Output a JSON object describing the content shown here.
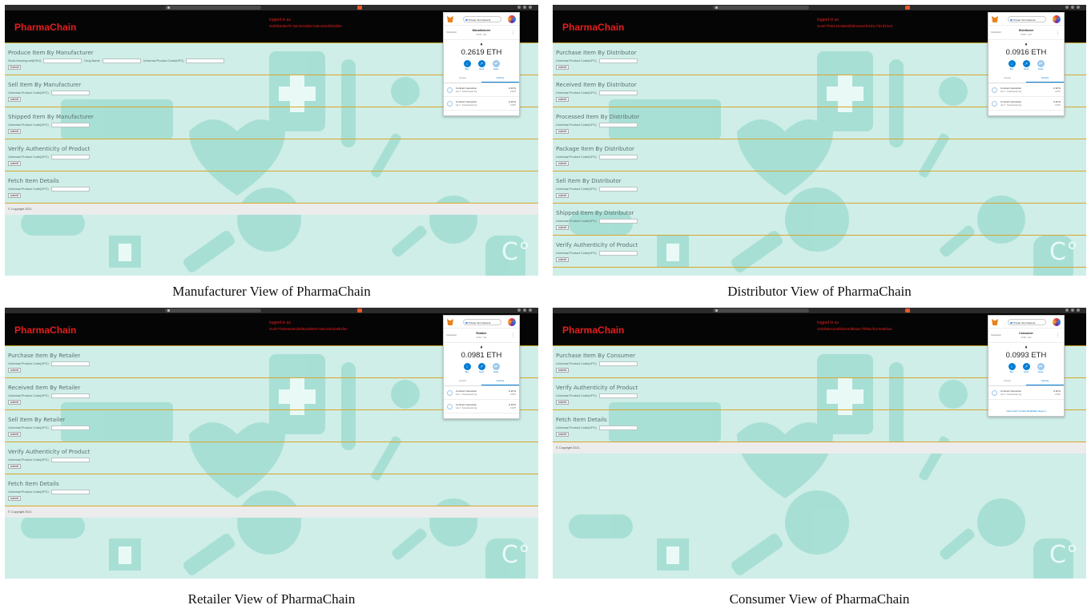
{
  "panels": [
    {
      "caption": "Manufacturer View of PharmaChain",
      "brand": "PharmaChain",
      "logged_label": "logged in as",
      "logged_address": "0x9f3ba09a7fc7a5c9c94d0c7a9e4e6c0f5d4bbe",
      "sections": [
        {
          "title": "Produce Item By Manufacturer",
          "fields": [
            "Stock keeping unit(SKU)",
            "Drug Name",
            "Universal Product Code(UPC)"
          ],
          "submit": "Submit"
        },
        {
          "title": "Sell Item By Manufacturer",
          "fields": [
            "Universal Product Code(UPC)"
          ],
          "submit": "submit"
        },
        {
          "title": "Shipped Item By Manufacturer",
          "fields": [
            "Universal Product Code(UPC)"
          ],
          "submit": "submit"
        },
        {
          "title": "Verify Authenticity of Product",
          "fields": [
            "Universal Product Code(UPC)"
          ],
          "submit": "submit"
        },
        {
          "title": "Fetch Item Details",
          "fields": [
            "Universal Product Code(UPC)"
          ],
          "submit": "submit"
        }
      ],
      "footer": "© Copyright 2021.",
      "metamask": {
        "network": "Private Test Network",
        "connected": "Connected",
        "account": "Manufacturer",
        "address": "0x9f3...bbe",
        "eth_icon": "♦",
        "balance": "0.2619 ETH",
        "actions": [
          "Buy",
          "Send",
          "Swap"
        ],
        "tabs": [
          "Assets",
          "Activity"
        ],
        "transactions": [
          {
            "title": "Contract Interaction",
            "sub": "Jan 3 · Tests/Interact.Ing",
            "amount": "-0 ETH",
            "fiat": "-0 ETH"
          },
          {
            "title": "Contract Interaction",
            "sub": "Jan 3 · Tests/Interact.Ing",
            "amount": "-0 ETH",
            "fiat": "-0 ETH"
          }
        ],
        "help": ""
      }
    },
    {
      "caption": "Distributor View of PharmaChain",
      "brand": "PharmaChain",
      "logged_label": "logged in as",
      "logged_address": "0x4877b60c1b4a5e9f26be4ea1f44d1c74b1f10e3",
      "sections": [
        {
          "title": "Purchase Item By Distributor",
          "fields": [
            "Universal Product Code(UPC)"
          ],
          "submit": "submit"
        },
        {
          "title": "Received Item By Distributor",
          "fields": [
            "Universal Product Code(UPC)"
          ],
          "submit": "submit"
        },
        {
          "title": "Processed Item By Distributor",
          "fields": [
            "Universal Product Code(UPC)"
          ],
          "submit": "submit"
        },
        {
          "title": "Package Item By Distributor",
          "fields": [
            "Universal Product Code(UPC)"
          ],
          "submit": "submit"
        },
        {
          "title": "Sell Item By Distributor",
          "fields": [
            "Universal Product Code(UPC)"
          ],
          "submit": "submit"
        },
        {
          "title": "Shipped Item By Distributor",
          "fields": [
            "Universal Product Code(UPC)"
          ],
          "submit": "submit"
        },
        {
          "title": "Verify Authenticity of Product",
          "fields": [
            "Universal Product Code(UPC)"
          ],
          "submit": "submit"
        }
      ],
      "footer": "",
      "metamask": {
        "network": "Private Test Network",
        "connected": "Connected",
        "account": "Distributor",
        "address": "0x487...0e3",
        "eth_icon": "♦",
        "balance": "0.0916 ETH",
        "actions": [
          "Buy",
          "Send",
          "Swap"
        ],
        "tabs": [
          "Assets",
          "Activity"
        ],
        "transactions": [
          {
            "title": "Contract Interaction",
            "sub": "Jan 3 · Tests/Interact.Ing",
            "amount": "-0 ETH",
            "fiat": "-0 ETH"
          },
          {
            "title": "Contract Interaction",
            "sub": "Jan 3 · Tests/Interact.Ing",
            "amount": "-0 ETH",
            "fiat": "-0 ETH"
          }
        ],
        "help": ""
      }
    },
    {
      "caption": "Retailer View of PharmaChain",
      "brand": "PharmaChain",
      "logged_label": "logged in as",
      "logged_address": "0x4b77b60e6a9e2b8f5a3d9e0c7a9c4e6d2a8b1f6e",
      "sections": [
        {
          "title": "Purchase Item By Retailer",
          "fields": [
            "Universal Product Code(UPC)"
          ],
          "submit": "submit"
        },
        {
          "title": "Received Item By Retailer",
          "fields": [
            "Universal Product Code(UPC)"
          ],
          "submit": "submit"
        },
        {
          "title": "Sell Item By Retailer",
          "fields": [
            "Universal Product Code(UPC)"
          ],
          "submit": "submit"
        },
        {
          "title": "Verify Authenticity of Product",
          "fields": [
            "Universal Product Code(UPC)"
          ],
          "submit": "submit"
        },
        {
          "title": "Fetch Item Details",
          "fields": [
            "Universal Product Code(UPC)"
          ],
          "submit": "submit"
        }
      ],
      "footer": "© Copyright 2021.",
      "metamask": {
        "network": "Private Test Network",
        "connected": "Connected",
        "account": "Retailer",
        "address": "0x4b7...f6e",
        "eth_icon": "♦",
        "balance": "0.0981 ETH",
        "actions": [
          "Buy",
          "Send",
          "Swap"
        ],
        "tabs": [
          "Assets",
          "Activity"
        ],
        "transactions": [
          {
            "title": "Contract Interaction",
            "sub": "Jan 3 · Tests/Interact.Ing",
            "amount": "-0 ETH",
            "fiat": "-0 ETH"
          },
          {
            "title": "Contract Interaction",
            "sub": "Jan 3 · Tests/Interact.Ing",
            "amount": "-0 ETH",
            "fiat": "-0 ETH"
          }
        ],
        "help": ""
      }
    },
    {
      "caption": "Consumer View of PharmaChain",
      "brand": "PharmaChain",
      "logged_label": "logged in as",
      "logged_address": "0x83fa0ec2a4f3b4e6d8f9a2c7f0f9a7b4c6e8d2a4",
      "sections": [
        {
          "title": "Purchase Item By Consumer",
          "fields": [
            "Universal Product Code(UPC)"
          ],
          "submit": "submit"
        },
        {
          "title": "Verify Authenticity of Product",
          "fields": [
            "Universal Product Code(UPC)"
          ],
          "submit": "submit"
        },
        {
          "title": "Fetch Item Details",
          "fields": [
            "Universal Product Code(UPC)"
          ],
          "submit": "submit"
        }
      ],
      "footer": "© Copyright 2021.",
      "metamask": {
        "network": "Private Test Network",
        "connected": "Connected",
        "account": "Consumer",
        "address": "0x83f...2a4",
        "eth_icon": "♦",
        "balance": "0.0993 ETH",
        "actions": [
          "Buy",
          "Send",
          "Swap"
        ],
        "tabs": [
          "Assets",
          "Activity"
        ],
        "transactions": [
          {
            "title": "Contract Interaction",
            "sub": "Jan 3 · Tests/Interact.Ing",
            "amount": "-0 ETH",
            "fiat": "-0 ETH"
          }
        ],
        "help": "Need help? Contact",
        "help_link": "MetaMask Support"
      }
    }
  ],
  "colors": {
    "brand_red": "#e51d1d",
    "header_bg": "#050505",
    "background_teal": "#cfeee8",
    "divider_gold": "#d9a62a",
    "metamask_blue": "#037dd6"
  }
}
